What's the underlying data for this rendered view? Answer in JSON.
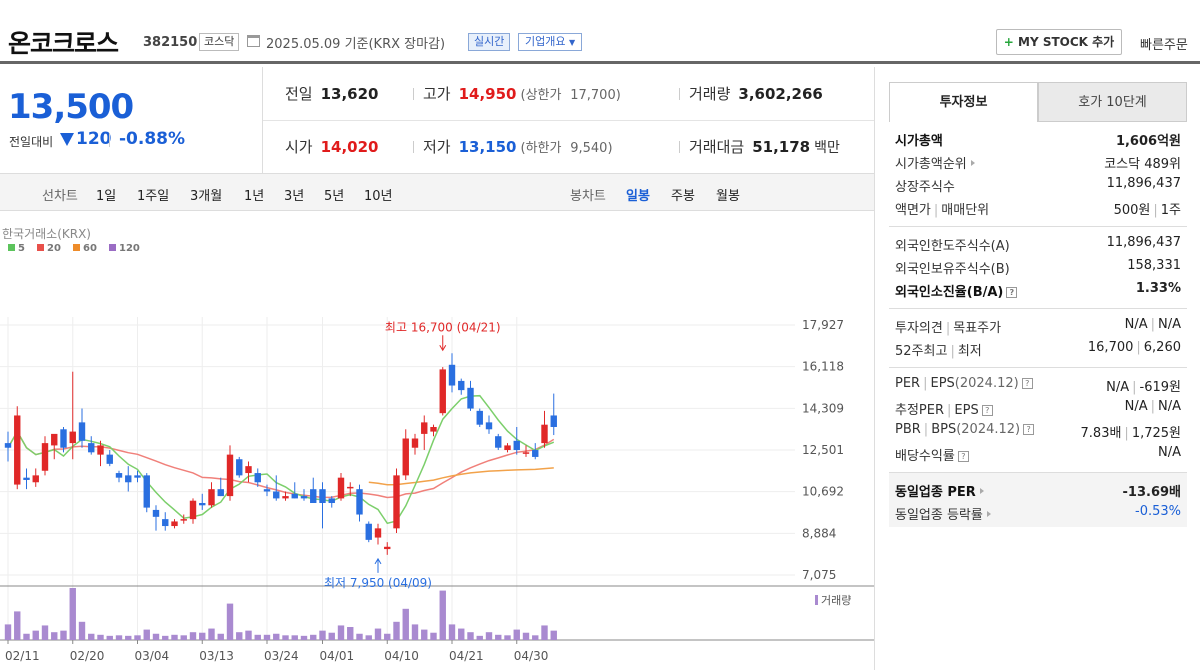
{
  "header": {
    "name": "온코크로스",
    "code": "382150",
    "market": "코스닥",
    "date": "2025.05.09  기준(KRX 장마감)",
    "realtime": "실시간",
    "overview": "기업개요",
    "mystock": "MY STOCK 추가",
    "quick": "빠른주문"
  },
  "price": {
    "current": "13,500",
    "change_label": "전일대비",
    "change_amount": "120",
    "change_rate": "-0.88%",
    "direction": "down"
  },
  "stats": {
    "prev_label": "전일",
    "prev": "13,620",
    "high_label": "고가",
    "high": "14,950",
    "upper_label": "(상한가",
    "upper": "17,700)",
    "volume_label": "거래량",
    "volume": "3,602,266",
    "open_label": "시가",
    "open": "14,020",
    "low_label": "저가",
    "low": "13,150",
    "lower_label": "(하한가",
    "lower": "9,540)",
    "value_label": "거래대금",
    "value": "51,178",
    "value_unit": "백만"
  },
  "toolbar": {
    "line_title": "선차트",
    "line_periods": [
      "1일",
      "1주일",
      "3개월",
      "1년",
      "3년",
      "5년",
      "10년"
    ],
    "candle_title": "봉차트",
    "candle_periods": [
      "일봉",
      "주봉",
      "월봉"
    ],
    "candle_active": "일봉"
  },
  "chart_data": {
    "type": "candlestick",
    "source": "한국거래소(KRX)",
    "legend": [
      {
        "name": "5",
        "color": "#5cc45c"
      },
      {
        "name": "20",
        "color": "#e8504a"
      },
      {
        "name": "60",
        "color": "#ee8c2a"
      },
      {
        "name": "120",
        "color": "#9a6cc4"
      }
    ],
    "y_ticks": [
      17927,
      16118,
      14309,
      12501,
      10692,
      8884,
      7075
    ],
    "ylim": [
      7075,
      17927
    ],
    "x_labels": [
      "02/11",
      "02/20",
      "03/04",
      "03/13",
      "03/24",
      "04/01",
      "04/10",
      "04/21",
      "04/30"
    ],
    "x_label_index": [
      0,
      7,
      14,
      21,
      28,
      34,
      41,
      48,
      55
    ],
    "max_annotation": {
      "text": "최고 16,700 (04/21)",
      "index": 47,
      "value": 16700
    },
    "min_annotation": {
      "text": "최저 7,950 (04/09)",
      "index": 40,
      "value": 7950
    },
    "volume_label": "거래량",
    "candles": [
      {
        "o": 12800,
        "h": 13300,
        "l": 12000,
        "c": 12600
      },
      {
        "o": 11000,
        "h": 14400,
        "l": 10800,
        "c": 14000
      },
      {
        "o": 11300,
        "h": 11700,
        "l": 10800,
        "c": 11200
      },
      {
        "o": 11100,
        "h": 11700,
        "l": 10900,
        "c": 11400
      },
      {
        "o": 11600,
        "h": 13100,
        "l": 11400,
        "c": 12800
      },
      {
        "o": 12700,
        "h": 13100,
        "l": 12100,
        "c": 13200
      },
      {
        "o": 13400,
        "h": 13500,
        "l": 12400,
        "c": 12600
      },
      {
        "o": 12800,
        "h": 15900,
        "l": 12100,
        "c": 13300
      },
      {
        "o": 13700,
        "h": 14300,
        "l": 12600,
        "c": 12900
      },
      {
        "o": 12800,
        "h": 13100,
        "l": 12300,
        "c": 12400
      },
      {
        "o": 12300,
        "h": 12900,
        "l": 11800,
        "c": 12700
      },
      {
        "o": 12300,
        "h": 12500,
        "l": 11800,
        "c": 11900
      },
      {
        "o": 11500,
        "h": 11600,
        "l": 11100,
        "c": 11300
      },
      {
        "o": 11400,
        "h": 11800,
        "l": 10700,
        "c": 11100
      },
      {
        "o": 11400,
        "h": 11600,
        "l": 11100,
        "c": 11300
      },
      {
        "o": 11400,
        "h": 11500,
        "l": 9800,
        "c": 10000
      },
      {
        "o": 9900,
        "h": 10100,
        "l": 9000,
        "c": 9600
      },
      {
        "o": 9500,
        "h": 9800,
        "l": 9000,
        "c": 9200
      },
      {
        "o": 9200,
        "h": 9500,
        "l": 9100,
        "c": 9400
      },
      {
        "o": 9500,
        "h": 9700,
        "l": 9300,
        "c": 9500
      },
      {
        "o": 9500,
        "h": 10400,
        "l": 9300,
        "c": 10300
      },
      {
        "o": 10200,
        "h": 10600,
        "l": 9900,
        "c": 10100
      },
      {
        "o": 10100,
        "h": 11100,
        "l": 10000,
        "c": 10800
      },
      {
        "o": 10800,
        "h": 11300,
        "l": 10500,
        "c": 10500
      },
      {
        "o": 10500,
        "h": 12700,
        "l": 10300,
        "c": 12300
      },
      {
        "o": 12100,
        "h": 12200,
        "l": 11300,
        "c": 11400
      },
      {
        "o": 11500,
        "h": 12000,
        "l": 11100,
        "c": 11800
      },
      {
        "o": 11500,
        "h": 11700,
        "l": 10900,
        "c": 11100
      },
      {
        "o": 10800,
        "h": 11000,
        "l": 10500,
        "c": 10700
      },
      {
        "o": 10700,
        "h": 11400,
        "l": 10300,
        "c": 10400
      },
      {
        "o": 10400,
        "h": 10700,
        "l": 10300,
        "c": 10500
      },
      {
        "o": 10600,
        "h": 11100,
        "l": 10400,
        "c": 10400
      },
      {
        "o": 10500,
        "h": 10800,
        "l": 10300,
        "c": 10400
      },
      {
        "o": 10800,
        "h": 11300,
        "l": 10300,
        "c": 10200
      },
      {
        "o": 10800,
        "h": 11100,
        "l": 9100,
        "c": 10200
      },
      {
        "o": 10400,
        "h": 10500,
        "l": 10000,
        "c": 10200
      },
      {
        "o": 10400,
        "h": 11500,
        "l": 10300,
        "c": 11300
      },
      {
        "o": 10900,
        "h": 11100,
        "l": 10500,
        "c": 10900
      },
      {
        "o": 10800,
        "h": 11000,
        "l": 9400,
        "c": 9700
      },
      {
        "o": 9300,
        "h": 9400,
        "l": 8500,
        "c": 8600
      },
      {
        "o": 8700,
        "h": 9300,
        "l": 8400,
        "c": 9100
      },
      {
        "o": 8200,
        "h": 8500,
        "l": 7950,
        "c": 8300
      },
      {
        "o": 9100,
        "h": 11700,
        "l": 8900,
        "c": 11400
      },
      {
        "o": 11400,
        "h": 13400,
        "l": 11200,
        "c": 13000
      },
      {
        "o": 12600,
        "h": 13200,
        "l": 12300,
        "c": 13000
      },
      {
        "o": 13200,
        "h": 14000,
        "l": 12500,
        "c": 13700
      },
      {
        "o": 13300,
        "h": 13600,
        "l": 13100,
        "c": 13500
      },
      {
        "o": 14100,
        "h": 16100,
        "l": 14000,
        "c": 16000
      },
      {
        "o": 16200,
        "h": 16700,
        "l": 15000,
        "c": 15300
      },
      {
        "o": 15500,
        "h": 15600,
        "l": 14900,
        "c": 15100
      },
      {
        "o": 15200,
        "h": 15500,
        "l": 14200,
        "c": 14300
      },
      {
        "o": 14200,
        "h": 14300,
        "l": 13500,
        "c": 13600
      },
      {
        "o": 13700,
        "h": 14000,
        "l": 13200,
        "c": 13400
      },
      {
        "o": 13100,
        "h": 13200,
        "l": 12500,
        "c": 12600
      },
      {
        "o": 12500,
        "h": 12800,
        "l": 12400,
        "c": 12700
      },
      {
        "o": 12900,
        "h": 13500,
        "l": 12300,
        "c": 12500
      },
      {
        "o": 12400,
        "h": 12700,
        "l": 12200,
        "c": 12400
      },
      {
        "o": 12500,
        "h": 12800,
        "l": 12100,
        "c": 12200
      },
      {
        "o": 12800,
        "h": 14200,
        "l": 12600,
        "c": 13600
      },
      {
        "o": 14000,
        "h": 14950,
        "l": 13150,
        "c": 13500
      }
    ],
    "volume": [
      30,
      55,
      12,
      18,
      28,
      15,
      18,
      100,
      35,
      12,
      10,
      8,
      9,
      8,
      9,
      20,
      12,
      8,
      10,
      9,
      15,
      14,
      22,
      12,
      70,
      15,
      18,
      10,
      10,
      12,
      9,
      9,
      8,
      10,
      18,
      14,
      28,
      25,
      12,
      9,
      22,
      12,
      35,
      60,
      30,
      20,
      14,
      95,
      30,
      22,
      15,
      8,
      15,
      10,
      9,
      20,
      14,
      9,
      28,
      18
    ]
  },
  "right": {
    "tab_active": "투자정보",
    "tab_other": "호가 10단계",
    "s1": [
      {
        "k": "시가총액",
        "v": "1,606억원",
        "bold": true
      },
      {
        "k": "시가총액순위",
        "v": "코스닥 489위",
        "arrow": true
      },
      {
        "k": "상장주식수",
        "v": "11,896,437"
      },
      {
        "k": "액면가",
        "k2": "매매단위",
        "v": "500원",
        "v2": "1주"
      }
    ],
    "s2": [
      {
        "k": "외국인한도주식수(A)",
        "v": "11,896,437"
      },
      {
        "k": "외국인보유주식수(B)",
        "v": "158,331"
      },
      {
        "k": "외국인소진율(B/A)",
        "v": "1.33%",
        "bold": true,
        "help": true
      }
    ],
    "s3": [
      {
        "k": "투자의견",
        "k2": "목표주가",
        "v": "N/A",
        "v2": "N/A"
      },
      {
        "k": "52주최고",
        "k2": "최저",
        "v": "16,700",
        "v2": "6,260"
      }
    ],
    "s4": [
      {
        "k": "PER",
        "k2": "EPS",
        "k3": "(2024.12)",
        "v": "N/A",
        "v2": "-619원"
      },
      {
        "k": "추정PER",
        "k2": "EPS",
        "v": "N/A",
        "v2": "N/A"
      },
      {
        "k": "PBR",
        "k2": "BPS",
        "k3": "(2024.12)",
        "v": "7.83배",
        "v2": "1,725원"
      },
      {
        "k": "배당수익률",
        "v": "N/A"
      }
    ],
    "s5": [
      {
        "k": "동일업종 PER",
        "v": "-13.69배",
        "bold": true
      },
      {
        "k": "동일업종 등락률",
        "v": "-0.53%",
        "blue": true
      }
    ]
  }
}
